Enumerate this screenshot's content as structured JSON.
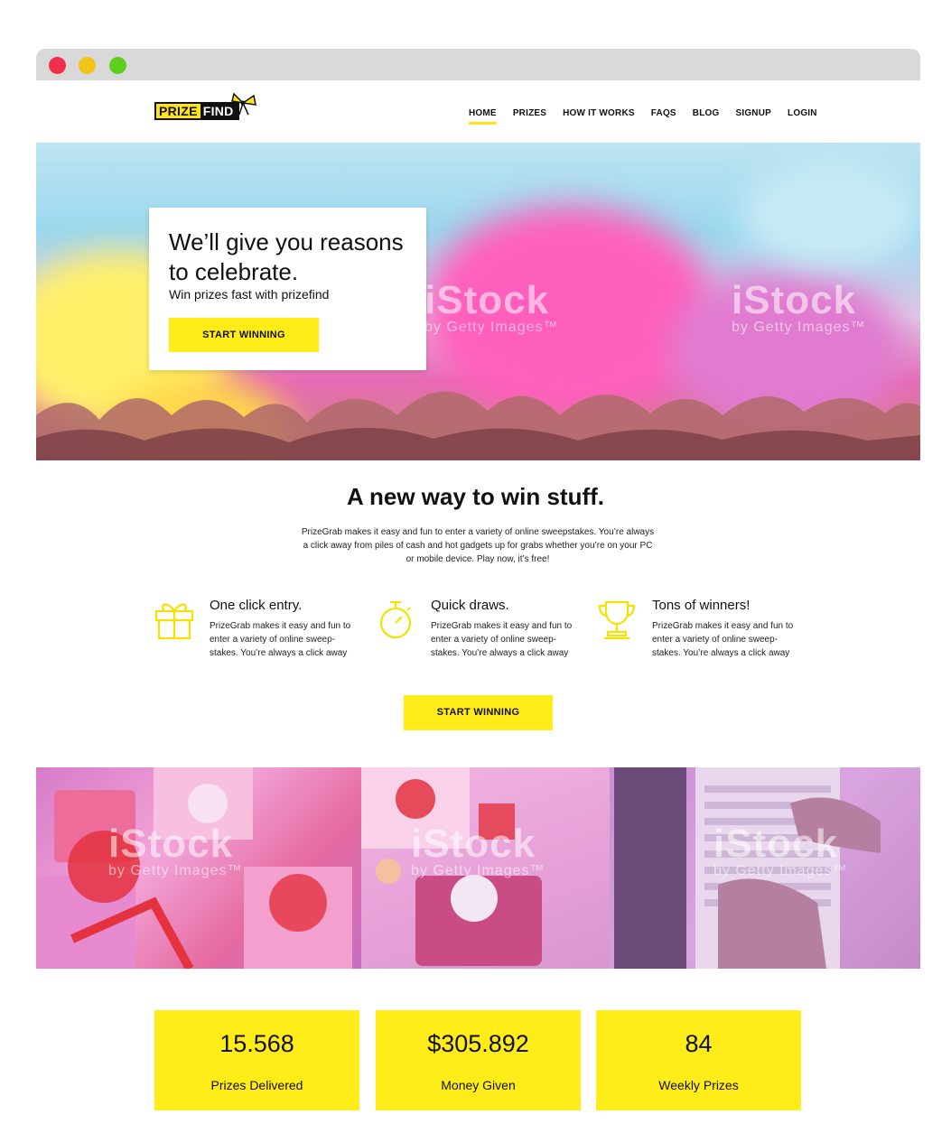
{
  "browser": {
    "dots": [
      "red",
      "yellow",
      "green"
    ]
  },
  "header": {
    "logo_prize": "PRIZE",
    "logo_find": "FIND",
    "nav": [
      {
        "label": "HOME",
        "active": true
      },
      {
        "label": "PRIZES",
        "active": false
      },
      {
        "label": "HOW IT WORKS",
        "active": false
      },
      {
        "label": "FAQS",
        "active": false
      },
      {
        "label": "BLOG",
        "active": false
      },
      {
        "label": "SIGNUP",
        "active": false
      },
      {
        "label": "LOGIN",
        "active": false
      }
    ]
  },
  "hero": {
    "title": "We’ll give you reasons to celebrate.",
    "subtitle": "Win prizes fast with prizefind",
    "button": "START WINNING",
    "watermark": "iStock",
    "watermark_sub": "by Getty Images™"
  },
  "intro": {
    "title": "A new way to win stuff.",
    "text": "PrizeGrab makes it easy and fun to enter a variety of online sweepstakes. You’re always a click away from piles of cash and hot gadgets up for grabs whether you’re on your PC or mobile device. Play now, it’s free!"
  },
  "features": [
    {
      "icon": "gift-icon",
      "title": "One click entry.",
      "text": "PrizeGrab makes it easy and fun to enter a variety of online sweep-stakes. You’re always a click away"
    },
    {
      "icon": "stopwatch-icon",
      "title": "Quick draws.",
      "text": "PrizeGrab makes it easy and fun to enter a variety of online sweep-stakes. You’re always a click away"
    },
    {
      "icon": "trophy-icon",
      "title": "Tons of winners!",
      "text": "PrizeGrab makes it easy and fun to enter a variety of online sweep-stakes. You’re always a click away"
    }
  ],
  "cta": {
    "button": "START WINNING"
  },
  "gallery": {
    "watermark": "iStock",
    "watermark_sub": "by Getty Images™"
  },
  "stats": [
    {
      "number": "15.568",
      "label": "Prizes Delivered"
    },
    {
      "number": "$305.892",
      "label": "Money Given"
    },
    {
      "number": "84",
      "label": "Weekly Prizes"
    }
  ],
  "colors": {
    "accent": "#ffec19",
    "text": "#111111",
    "icon": "#f5e200"
  }
}
